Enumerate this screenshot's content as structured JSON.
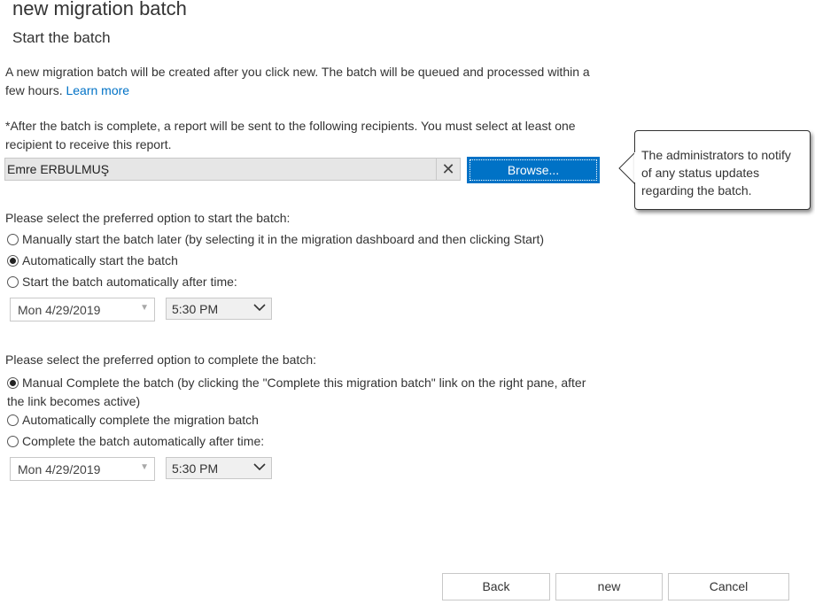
{
  "header": {
    "title": "new migration batch",
    "subtitle": "Start the batch"
  },
  "intro": {
    "text": "A new migration batch will be created after you click new. The batch will be queued and processed within a few hours.",
    "link": "Learn more"
  },
  "recipients": {
    "label": "*After the batch is complete, a report will be sent to the following recipients. You must select at least one recipient to receive this report.",
    "value": "Emre ERBULMUŞ",
    "clear_glyph": "✕",
    "browse_label": "Browse...",
    "tooltip": "The administrators to notify of any status updates regarding the batch."
  },
  "start": {
    "label": "Please select the preferred option to start the batch:",
    "options": [
      {
        "label": "Manually start the batch later (by selecting it in the migration dashboard and then clicking Start)",
        "selected": false
      },
      {
        "label": "Automatically start the batch",
        "selected": true
      },
      {
        "label": "Start the batch automatically after time:",
        "selected": false
      }
    ],
    "date": "Mon 4/29/2019",
    "time": "5:30 PM"
  },
  "complete": {
    "label": "Please select the preferred option to complete the batch:",
    "options": [
      {
        "label": "Manual Complete the batch (by clicking the \"Complete this migration batch\" link on the right pane, after the link becomes active)",
        "selected": true
      },
      {
        "label": "Automatically complete the migration batch",
        "selected": false
      },
      {
        "label": "Complete the batch automatically after time:",
        "selected": false
      }
    ],
    "date": "Mon 4/29/2019",
    "time": "5:30 PM"
  },
  "footer": {
    "back": "Back",
    "new": "new",
    "cancel": "Cancel"
  },
  "colors": {
    "accent": "#0072c6",
    "text": "#333333",
    "border": "#c8c8c8"
  },
  "icons": {
    "clear": "close-icon",
    "date_dropdown": "chevron-down-icon",
    "time_dropdown": "chevron-down-icon"
  }
}
